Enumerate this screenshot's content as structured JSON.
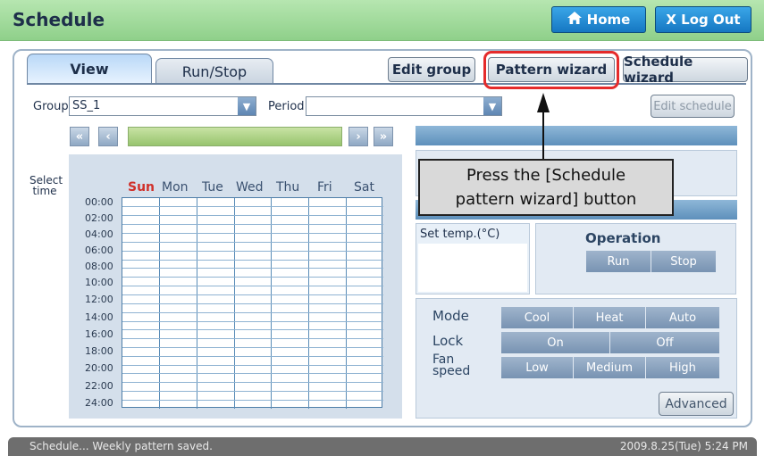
{
  "header": {
    "title": "Schedule",
    "home_label": "Home",
    "logout_label": "X Log Out",
    "colors": {
      "bar": "#9ddc97",
      "button": "#2a8fd8"
    }
  },
  "tabs": [
    {
      "label": "View",
      "active": true
    },
    {
      "label": "Run/Stop",
      "active": false
    }
  ],
  "toolbar": {
    "edit_group": "Edit group",
    "pattern_wizard": "Pattern wizard",
    "schedule_wizard": "Schedule wizard"
  },
  "filters": {
    "group_label": "Group",
    "group_value": "SS_1",
    "period_label": "Period",
    "period_value": "",
    "edit_schedule": "Edit schedule"
  },
  "schedule": {
    "select_time": "Select time",
    "days": [
      "Sun",
      "Mon",
      "Tue",
      "Wed",
      "Thu",
      "Fri",
      "Sat"
    ],
    "times": [
      "00:00",
      "02:00",
      "04:00",
      "06:00",
      "08:00",
      "10:00",
      "12:00",
      "14:00",
      "16:00",
      "18:00",
      "20:00",
      "22:00",
      "24:00"
    ],
    "sunday_color": "#d0302a"
  },
  "settings": {
    "set_temp_label": "Set temp.(°C)",
    "operation_label": "Operation",
    "operation_options": [
      "Run",
      "Stop"
    ],
    "mode_label": "Mode",
    "mode_options": [
      "Cool",
      "Heat",
      "Auto"
    ],
    "lock_label": "Lock",
    "lock_options": [
      "On",
      "Off"
    ],
    "fan_label": "Fan speed",
    "fan_options": [
      "Low",
      "Medium",
      "High"
    ],
    "advanced": "Advanced"
  },
  "callout": {
    "line1": "Press the [Schedule",
    "line2": "pattern wizard] button"
  },
  "status": {
    "message": "Schedule... Weekly pattern saved.",
    "datetime": "2009.8.25(Tue) 5:24 PM"
  }
}
